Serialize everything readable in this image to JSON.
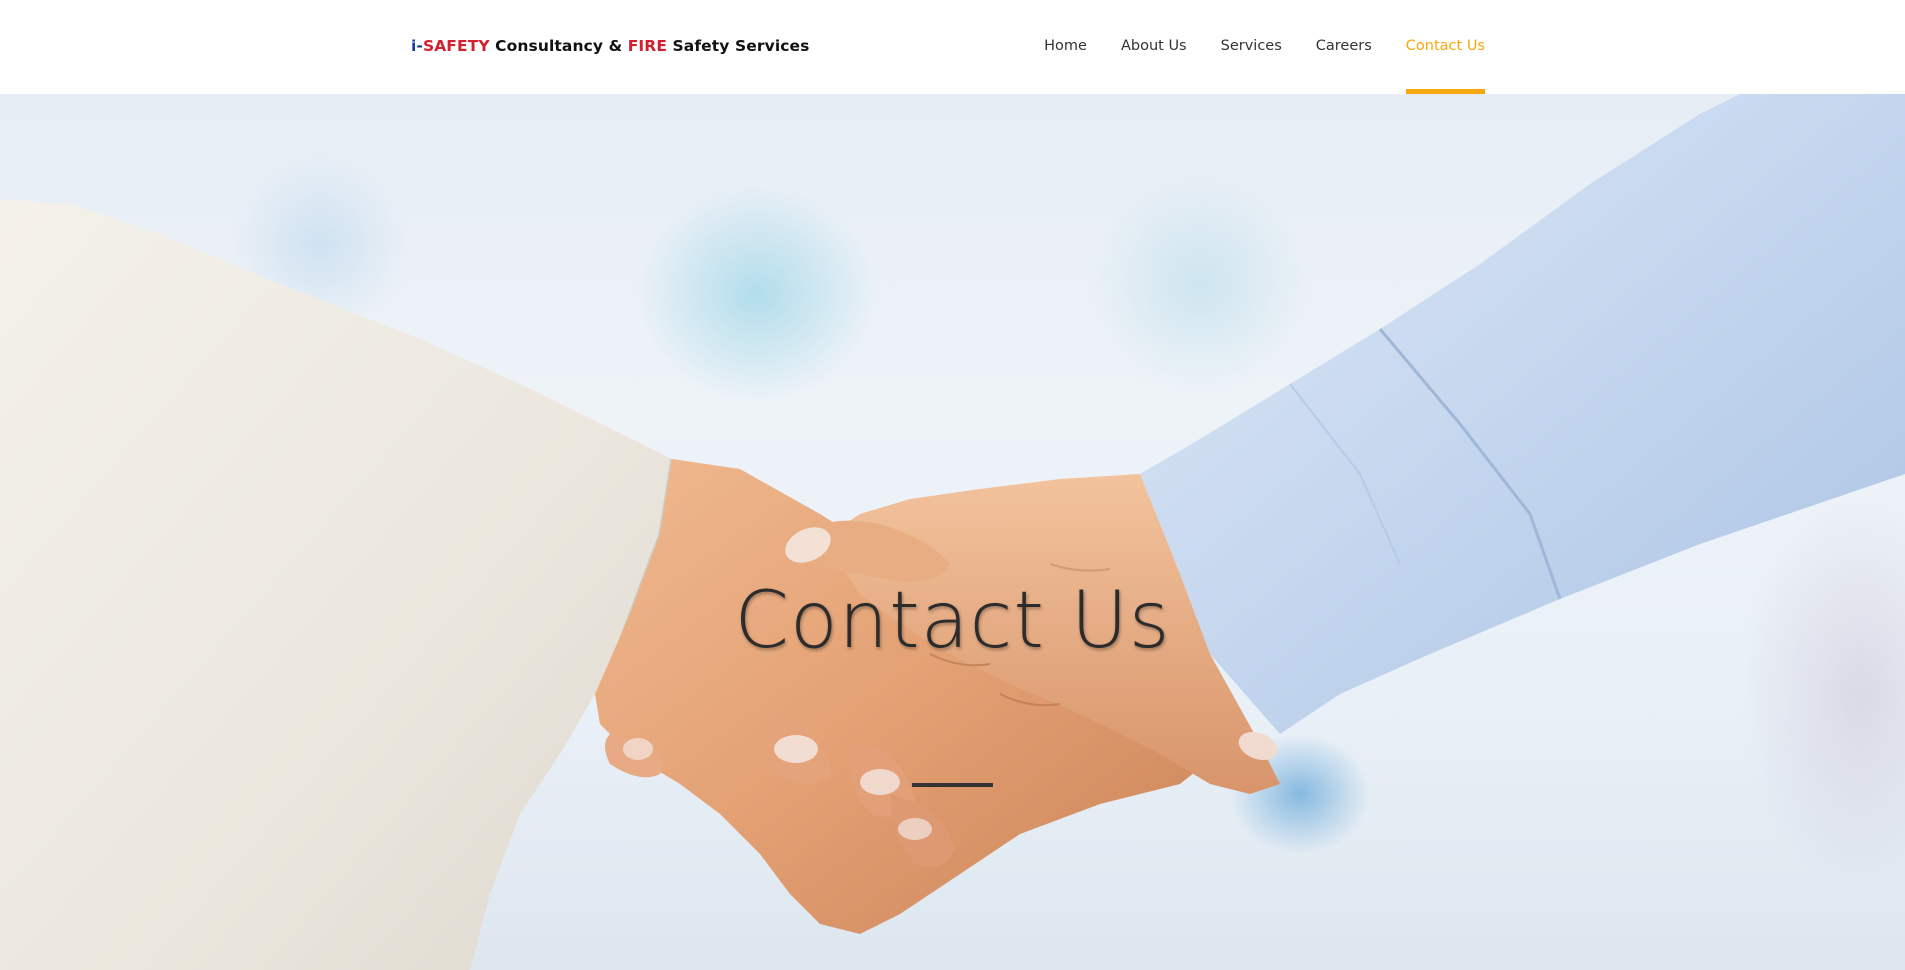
{
  "logo": {
    "i": "i-",
    "safety": "SAFETY",
    "consultancy": " Consultancy & ",
    "fire": "FIRE",
    "services": " Safety Services"
  },
  "nav": {
    "items": [
      {
        "label": "Home",
        "active": false
      },
      {
        "label": "About Us",
        "active": false
      },
      {
        "label": "Services",
        "active": false
      },
      {
        "label": "Careers",
        "active": false
      },
      {
        "label": "Contact Us",
        "active": true
      }
    ]
  },
  "hero": {
    "title": "Contact Us"
  },
  "colors": {
    "accent": "#f5a70c",
    "logo_red": "#d2202f",
    "logo_blue": "#1d3c9a",
    "text_dark": "#333333"
  }
}
